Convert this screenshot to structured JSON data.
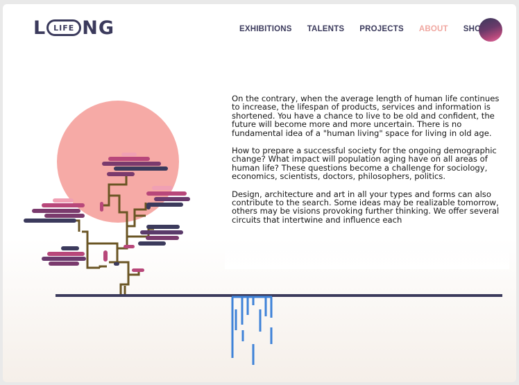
{
  "logo": {
    "lead": "L",
    "pill": "LIFE",
    "tail": "NG"
  },
  "nav": [
    {
      "label": "EXHIBITIONS",
      "active": false
    },
    {
      "label": "TALENTS",
      "active": false
    },
    {
      "label": "PROJECTS",
      "active": false
    },
    {
      "label": "ABOUT",
      "active": true
    },
    {
      "label": "SHOP",
      "active": false
    }
  ],
  "content": {
    "p1": "On the contrary, when the average length of human life continues to increase, the lifespan of products, services and information is shortened. You have a chance to live to be old and confident, the future will become more and more uncertain. There is no fundamental idea of a \"human living\" space for living in old age.",
    "p2": "How to prepare a successful society for the ongoing demographic change? What impact will population aging have on all areas of human life? These questions become a challenge for sociology, economics, scientists, doctors, philosophers, politics.",
    "p3": "Design, architecture and art in all your types and forms can also contribute to the search. Some ideas may be realizable tomorrow, others may be visions provoking further thinking. We offer several circuits that intertwine and influence each"
  },
  "colors": {
    "navy": "#3b3a5c",
    "accent": "#f0a7a0",
    "sun": "#f6aaa6",
    "blue": "#3e82d8",
    "trunk": "#6a5524"
  }
}
